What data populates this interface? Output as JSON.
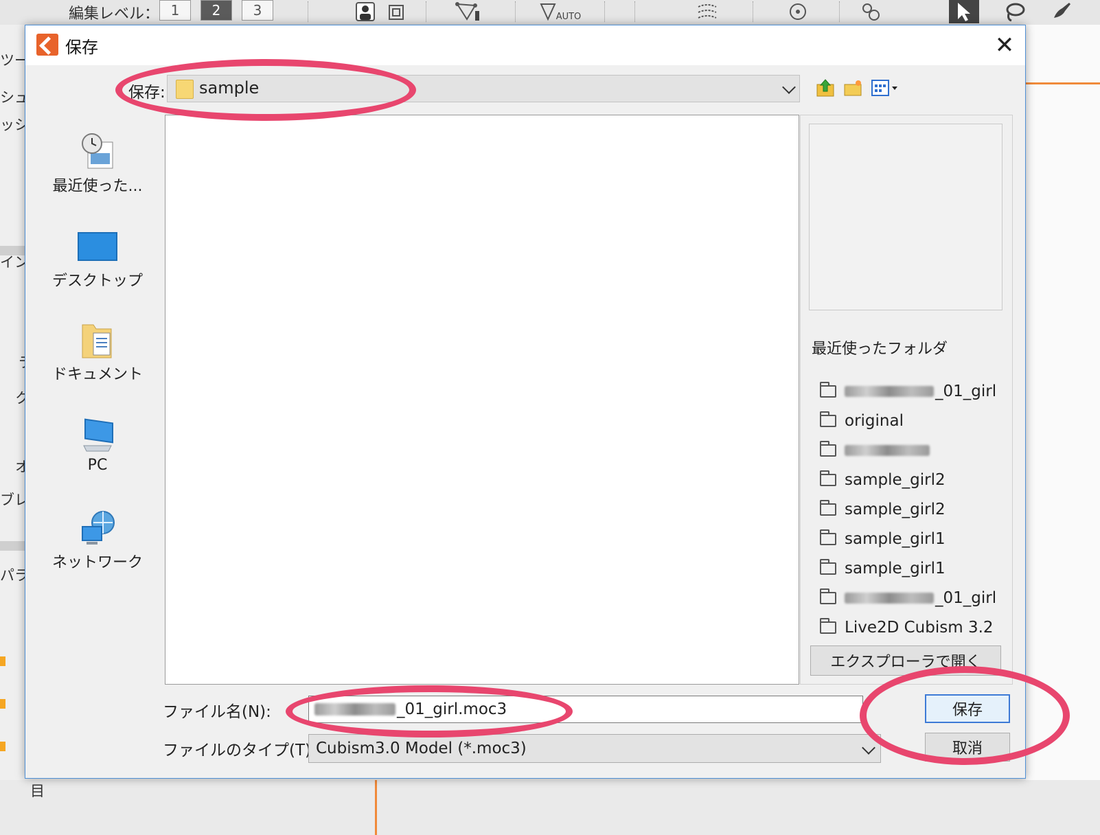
{
  "background_app": {
    "edit_level_label": "編集レベル：",
    "levels": [
      "1",
      "2",
      "3"
    ],
    "active_level": "2",
    "auto_label": "AUTO",
    "left_panel_texts": [
      "ツー",
      "シュ",
      "ッシ",
      "イン",
      "ラ",
      "ク",
      "オ",
      "ブレ",
      "パラ",
      "目"
    ]
  },
  "dialog": {
    "title": "保存",
    "close_glyph": "✕",
    "save_in_label": "保存:",
    "location": "sample",
    "places": [
      {
        "label": "最近使った...",
        "icon": "recent-places-icon"
      },
      {
        "label": "デスクトップ",
        "icon": "desktop-icon"
      },
      {
        "label": "ドキュメント",
        "icon": "documents-icon"
      },
      {
        "label": "PC",
        "icon": "pc-icon"
      },
      {
        "label": "ネットワーク",
        "icon": "network-icon"
      }
    ],
    "recent_title": "最近使ったフォルダ",
    "recent_folders": [
      {
        "name": "_01_girl",
        "blurred_prefix": true
      },
      {
        "name": "original",
        "blurred_prefix": false
      },
      {
        "name": "",
        "blurred_prefix": true
      },
      {
        "name": "sample_girl2",
        "blurred_prefix": false
      },
      {
        "name": "sample_girl2",
        "blurred_prefix": false
      },
      {
        "name": "sample_girl1",
        "blurred_prefix": false
      },
      {
        "name": "sample_girl1",
        "blurred_prefix": false
      },
      {
        "name": "_01_girl",
        "blurred_prefix": true
      },
      {
        "name": "Live2D Cubism 3.2",
        "blurred_prefix": false
      }
    ],
    "explorer_button": "エクスプローラで開く",
    "filename_label": "ファイル名(N):",
    "filename_value": "_01_girl.moc3",
    "filetype_label": "ファイルのタイプ(T):",
    "filetype_value": "Cubism3.0 Model (*.moc3)",
    "save_button": "保存",
    "cancel_button": "取消"
  },
  "colors": {
    "annotation": "#e8466e",
    "dialog_border": "#4e8fd6",
    "default_button_border": "#3d7ad6",
    "app_logo": "#e8632b"
  }
}
